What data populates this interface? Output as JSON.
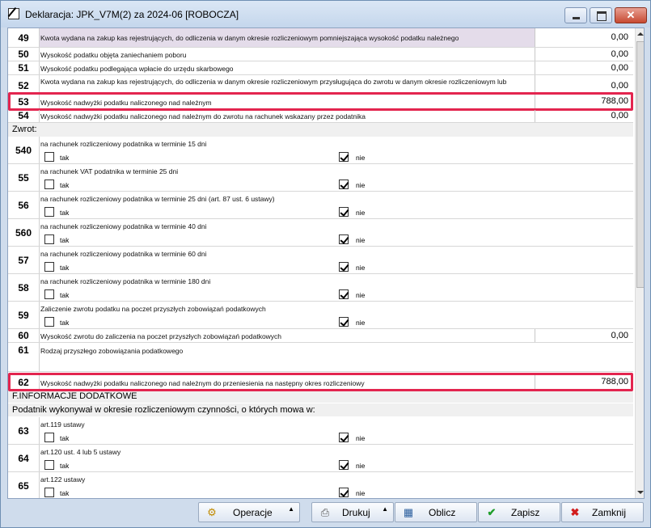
{
  "window": {
    "title": "Deklaracja: JPK_V7M(2) za 2024-06   [ROBOCZA]"
  },
  "rows": [
    {
      "num": "49",
      "desc": "Kwota wydana na zakup kas rejestrujących, do odliczenia w danym okresie rozliczeniowym pomniejszająca wysokość podatku należnego",
      "value": "0,00"
    },
    {
      "num": "50",
      "desc": "Wysokość podatku objęta zaniechaniem poboru",
      "value": "0,00"
    },
    {
      "num": "51",
      "desc": "Wysokość podatku podlegająca wpłacie do urzędu skarbowego",
      "value": "0,00"
    },
    {
      "num": "52",
      "desc": "Kwota wydana na zakup kas rejestrujących, do odliczenia w danym okresie rozliczeniowym przysługująca do zwrotu w danym okresie rozliczeniowym lub",
      "value": "0,00"
    },
    {
      "num": "53",
      "desc": "Wysokość nadwyżki podatku naliczonego nad należnym",
      "value": "788,00"
    },
    {
      "num": "54",
      "desc": "Wysokość nadwyżki podatku naliczonego nad należnym do zwrotu na rachunek wskazany przez podatnika",
      "value": "0,00"
    }
  ],
  "zwrot_label": "Zwrot:",
  "checkbox_rows": [
    {
      "num": "540",
      "desc": "na rachunek rozliczeniowy podatnika w terminie 15 dni",
      "tak": "tak",
      "nie": "nie"
    },
    {
      "num": "55",
      "desc": "na rachunek VAT podatnika w terminie 25 dni",
      "tak": "tak",
      "nie": "nie"
    },
    {
      "num": "56",
      "desc": "na rachunek rozliczeniowy podatnika w terminie 25 dni (art. 87 ust. 6 ustawy)",
      "tak": "tak",
      "nie": "nie"
    },
    {
      "num": "560",
      "desc": "na rachunek rozliczeniowy podatnika w terminie 40 dni",
      "tak": "tak",
      "nie": "nie"
    },
    {
      "num": "57",
      "desc": "na rachunek rozliczeniowy podatnika w terminie 60 dni",
      "tak": "tak",
      "nie": "nie"
    },
    {
      "num": "58",
      "desc": "na rachunek rozliczeniowy podatnika w terminie 180 dni",
      "tak": "tak",
      "nie": "nie"
    },
    {
      "num": "59",
      "desc": "Zaliczenie zwrotu podatku na poczet przyszłych zobowiązań podatkowych",
      "tak": "tak",
      "nie": "nie"
    }
  ],
  "row60": {
    "num": "60",
    "desc": "Wysokość zwrotu do zaliczenia na poczet przyszłych zobowiązań podatkowych",
    "value": "0,00"
  },
  "row61": {
    "num": "61",
    "desc": "Rodzaj przyszłego zobowiązania podatkowego"
  },
  "row62": {
    "num": "62",
    "desc": "Wysokość nadwyżki podatku naliczonego nad należnym do przeniesienia na następny okres rozliczeniowy",
    "value": "788,00"
  },
  "section_f": "F.INFORMACJE DODATKOWE",
  "section_f_sub": "Podatnik wykonywał w okresie rozliczeniowym czynności, o których mowa w:",
  "f_rows": [
    {
      "num": "63",
      "desc": "art.119 ustawy",
      "tak": "tak",
      "nie": "nie"
    },
    {
      "num": "64",
      "desc": "art.120 ust. 4 lub 5 ustawy",
      "tak": "tak",
      "nie": "nie"
    },
    {
      "num": "65",
      "desc": "art.122 ustawy",
      "tak": "tak",
      "nie": "nie"
    }
  ],
  "buttons": {
    "operacje": "Operacje",
    "drukuj": "Drukuj",
    "oblicz": "Oblicz",
    "zapisz": "Zapisz",
    "zamknij": "Zamknij"
  },
  "colors": {
    "highlight": "#e3254f",
    "row49_bg": "#e4dcea"
  }
}
